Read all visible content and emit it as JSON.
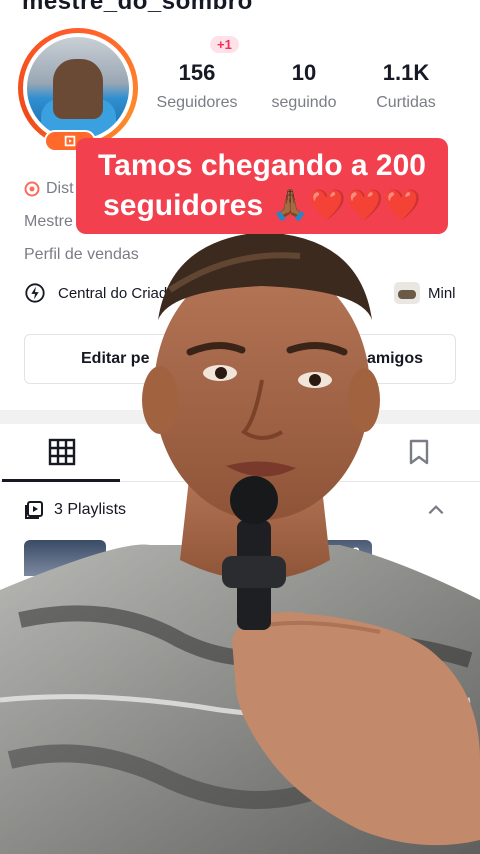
{
  "profile": {
    "username_cut": "mestre_do_sombro",
    "stats": [
      {
        "value": "156",
        "label": "Seguidores"
      },
      {
        "value": "10",
        "label": "seguindo"
      },
      {
        "value": "1.1K",
        "label": "Curtidas"
      }
    ],
    "follower_delta": "+1",
    "bio_lines": [
      "Dist",
      "Mestre",
      "Perfil de vendas"
    ]
  },
  "links": {
    "creator_center": "Central do Criado",
    "mini": "Minl"
  },
  "buttons": {
    "edit": "Editar pe",
    "friends": "amigos"
  },
  "playlists": {
    "label": "3 Playlists",
    "thumb_count": "2"
  },
  "caption": {
    "line1": "Tamos chegando a 200",
    "line2": "seguidores 🙏🏾❤️❤️❤️"
  },
  "colors": {
    "caption_bg": "#f2404f",
    "accent_pink": "#fe2c55",
    "avatar_ring": "#ff6a2b"
  },
  "icons": [
    "live-icon",
    "flag-icon",
    "creator-center-icon",
    "grid-icon",
    "bookmark-icon",
    "playlist-icon",
    "chevron-up-icon"
  ]
}
